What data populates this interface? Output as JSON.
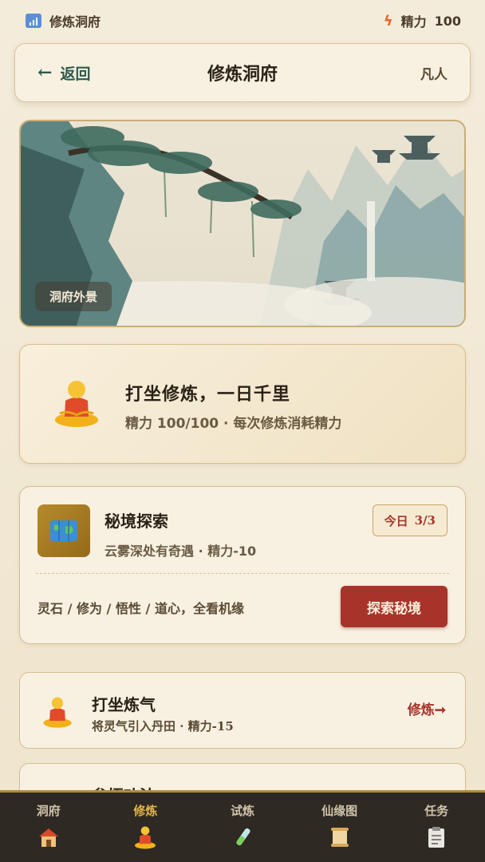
{
  "status": {
    "left_label": "修炼洞府",
    "energy_label": "精力",
    "energy_value": "100"
  },
  "header": {
    "back_label": "返回",
    "title": "修炼洞府",
    "rank": "凡人"
  },
  "scene": {
    "label": "洞府外景"
  },
  "meditation": {
    "title": "打坐修炼，一日千里",
    "subtitle": "精力 100/100 · 每次修炼消耗精力"
  },
  "explore": {
    "title": "秘境探索",
    "subtitle": "云雾深处有奇遇 · 精力-10",
    "badge_prefix": "今日",
    "badge_count": "3/3",
    "description": "灵石 / 修为 / 悟性 / 道心，全看机缘",
    "button": "探索秘境"
  },
  "actions": [
    {
      "title": "打坐炼气",
      "subtitle": "将灵气引入丹田  ·  精力-15",
      "action": "修炼➞"
    },
    {
      "title": "参悟功法",
      "subtitle": "",
      "action": ""
    }
  ],
  "nav": [
    {
      "label": "洞府",
      "icon": "house-icon"
    },
    {
      "label": "修炼",
      "icon": "meditation-icon"
    },
    {
      "label": "试炼",
      "icon": "potion-icon"
    },
    {
      "label": "仙缘图",
      "icon": "scroll-icon"
    },
    {
      "label": "任务",
      "icon": "clipboard-icon"
    }
  ],
  "colors": {
    "accent": "#a8332a",
    "gold": "#e3b448",
    "nav_bg": "#2e2922"
  }
}
